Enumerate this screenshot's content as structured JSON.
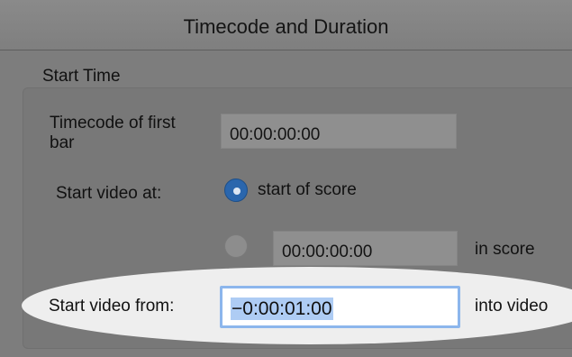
{
  "dialog": {
    "title": "Timecode and Duration"
  },
  "start_time": {
    "group_label": "Start Time",
    "first_bar_label_line1": "Timecode of first",
    "first_bar_label_line2": "bar",
    "first_bar_value": "00:00:00:00",
    "start_video_at_label": "Start video at:",
    "option_start_of_score": "start of score",
    "option_timecode_value": "00:00:00:00",
    "option_timecode_suffix": "in score",
    "selected_option": "start of score",
    "start_video_from_label": "Start video from:",
    "start_video_from_value": "−0:00:01:00",
    "start_video_from_suffix": "into video"
  }
}
